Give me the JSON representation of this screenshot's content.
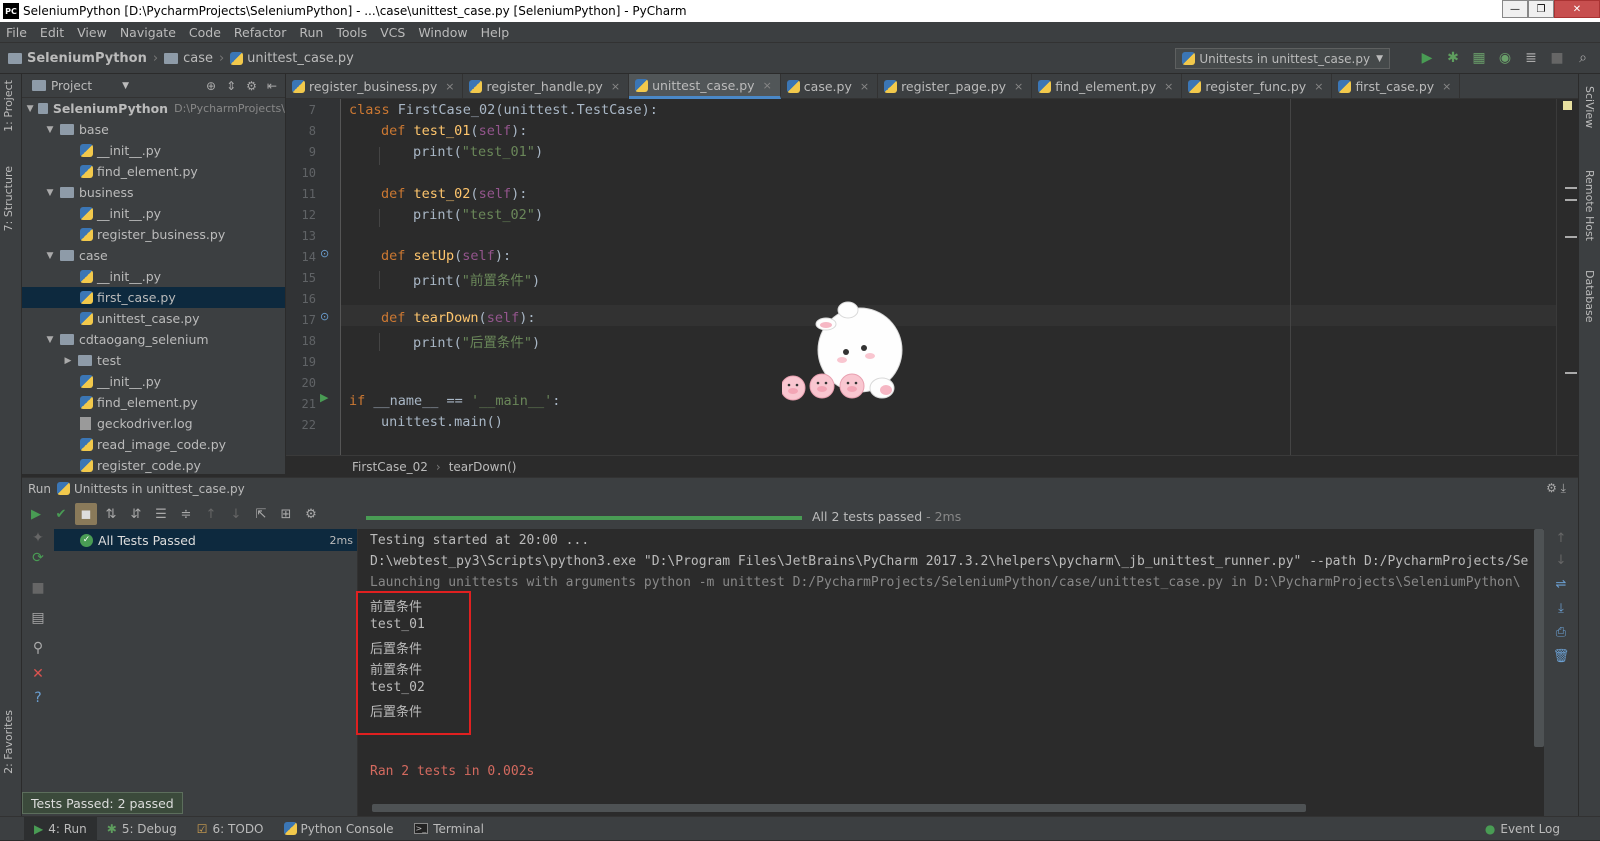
{
  "window": {
    "title": "SeleniumPython [D:\\PycharmProjects\\SeleniumPython] - ...\\case\\unittest_case.py [SeleniumPython] - PyCharm",
    "app_icon": "PC"
  },
  "menu": [
    "File",
    "Edit",
    "View",
    "Navigate",
    "Code",
    "Refactor",
    "Run",
    "Tools",
    "VCS",
    "Window",
    "Help"
  ],
  "nav": {
    "project": "SeleniumPython",
    "folder": "case",
    "file": "unittest_case.py",
    "run_config": "Unittests in unittest_case.py"
  },
  "left_tabs": {
    "project": "1: Project",
    "structure": "7: Structure",
    "favorites": "2: Favorites"
  },
  "right_tabs": {
    "sciview": "SciView",
    "remote": "Remote Host",
    "database": "Database"
  },
  "project_panel": {
    "title": "Project",
    "root": "SeleniumPython",
    "root_path": "D:\\PycharmProjects\\",
    "items": [
      {
        "label": "base",
        "type": "folder",
        "depth": 1
      },
      {
        "label": "__init__.py",
        "type": "py",
        "depth": 2
      },
      {
        "label": "find_element.py",
        "type": "py",
        "depth": 2
      },
      {
        "label": "business",
        "type": "folder",
        "depth": 1
      },
      {
        "label": "__init__.py",
        "type": "py",
        "depth": 2
      },
      {
        "label": "register_business.py",
        "type": "py",
        "depth": 2
      },
      {
        "label": "case",
        "type": "folder",
        "depth": 1
      },
      {
        "label": "__init__.py",
        "type": "py",
        "depth": 2
      },
      {
        "label": "first_case.py",
        "type": "py",
        "depth": 2
      },
      {
        "label": "unittest_case.py",
        "type": "py",
        "depth": 2
      },
      {
        "label": "cdtaogang_selenium",
        "type": "folder",
        "depth": 1
      },
      {
        "label": "test",
        "type": "folder-collapsed",
        "depth": 2
      },
      {
        "label": "__init__.py",
        "type": "py",
        "depth": 2
      },
      {
        "label": "find_element.py",
        "type": "py",
        "depth": 2
      },
      {
        "label": "geckodriver.log",
        "type": "log",
        "depth": 2
      },
      {
        "label": "read_image_code.py",
        "type": "py",
        "depth": 2
      },
      {
        "label": "register_code.py",
        "type": "py",
        "depth": 2
      }
    ]
  },
  "tabs": [
    {
      "label": "register_business.py",
      "active": false
    },
    {
      "label": "register_handle.py",
      "active": false
    },
    {
      "label": "unittest_case.py",
      "active": true
    },
    {
      "label": "case.py",
      "active": false
    },
    {
      "label": "register_page.py",
      "active": false
    },
    {
      "label": "find_element.py",
      "active": false
    },
    {
      "label": "register_func.py",
      "active": false
    },
    {
      "label": "first_case.py",
      "active": false
    }
  ],
  "code": {
    "line_numbers": [
      "7",
      "8",
      "9",
      "10",
      "11",
      "12",
      "13",
      "14",
      "15",
      "16",
      "17",
      "18",
      "19",
      "20",
      "21",
      "22"
    ],
    "l7": {
      "kw": "class ",
      "name": "FirstCase_02",
      "rest": "(unittest.TestCase):"
    },
    "l8": {
      "kw": "def ",
      "fn": "test_01",
      "p1": "(",
      "self": "self",
      "p2": "):"
    },
    "l9": {
      "call": "print(",
      "str": "\"test_01\"",
      "end": ")"
    },
    "l11": {
      "kw": "def ",
      "fn": "test_02",
      "p1": "(",
      "self": "self",
      "p2": "):"
    },
    "l12": {
      "call": "print(",
      "str": "\"test_02\"",
      "end": ")"
    },
    "l14": {
      "kw": "def ",
      "fn": "setUp",
      "p1": "(",
      "self": "self",
      "p2": "):"
    },
    "l15": {
      "call": "print(",
      "str": "\"前置条件\"",
      "end": ")"
    },
    "l17": {
      "kw": "def ",
      "fn": "tearDown",
      "p1": "(",
      "self": "self",
      "p2": "):"
    },
    "l18": {
      "call": "print(",
      "str": "\"后置条件\"",
      "end": ")"
    },
    "l21": {
      "kw": "if ",
      "mid": "__name__ == ",
      "str": "'__main__'",
      "end": ":"
    },
    "l22": {
      "text": "unittest.main()"
    }
  },
  "breadcrumb": {
    "class": "FirstCase_02",
    "method": "tearDown()"
  },
  "run": {
    "header": "Run",
    "config": "Unittests in unittest_case.py",
    "status": "All 2 tests passed",
    "status_time": " - 2ms",
    "tree_root": "All Tests Passed",
    "tree_time": "2ms",
    "console": [
      "Testing started at 20:00 ...",
      "D:\\webtest_py3\\Scripts\\python3.exe \"D:\\Program Files\\JetBrains\\PyCharm 2017.3.2\\helpers\\pycharm\\_jb_unittest_runner.py\" --path D:/PycharmProjects/Se",
      "Launching unittests with arguments python -m unittest D:/PycharmProjects/SeleniumPython/case/unittest_case.py in D:\\PycharmProjects\\SeleniumPython\\",
      "前置条件",
      "test_01",
      "后置条件",
      "前置条件",
      "test_02",
      "后置条件",
      "",
      "",
      "Ran 2 tests in 0.002s"
    ],
    "tooltip": "Tests Passed: 2 passed"
  },
  "statusbar": {
    "run": "4: Run",
    "debug": "5: Debug",
    "todo": "6: TODO",
    "console": "Python Console",
    "terminal": "Terminal",
    "event_log": "Event Log"
  },
  "colors": {
    "accent": "#4a88c7",
    "pass": "#499c54",
    "highlight_box": "#e02020"
  }
}
